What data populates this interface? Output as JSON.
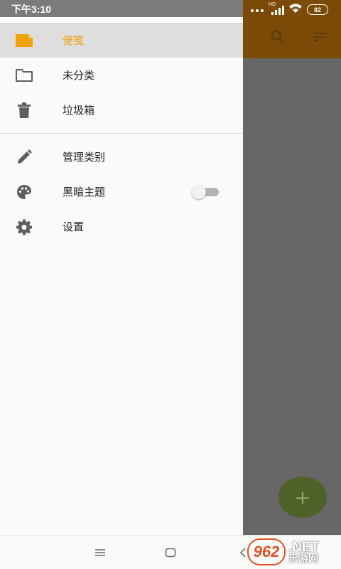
{
  "status_bar": {
    "time": "下午3:10",
    "network": "HD",
    "battery": "82"
  },
  "drawer": {
    "items": [
      {
        "label": "便笺",
        "icon": "note-icon",
        "selected": true
      },
      {
        "label": "未分类",
        "icon": "folder-icon",
        "selected": false
      },
      {
        "label": "垃圾箱",
        "icon": "trash-icon",
        "selected": false
      }
    ],
    "settings_items": [
      {
        "label": "管理类别",
        "icon": "pencil-icon"
      },
      {
        "label": "黑暗主题",
        "icon": "palette-icon",
        "toggle": false
      },
      {
        "label": "设置",
        "icon": "gear-icon"
      }
    ]
  },
  "app": {
    "fab_label": "+",
    "toolbar_icons": [
      "search-icon",
      "sort-icon"
    ]
  },
  "watermark": {
    "logo": "962",
    "net": ".NET",
    "cn": "乐游网"
  },
  "colors": {
    "accent": "#f0a30a",
    "selected_bg": "#dedede",
    "scrim": "#676767",
    "fab": "#4d6128"
  }
}
